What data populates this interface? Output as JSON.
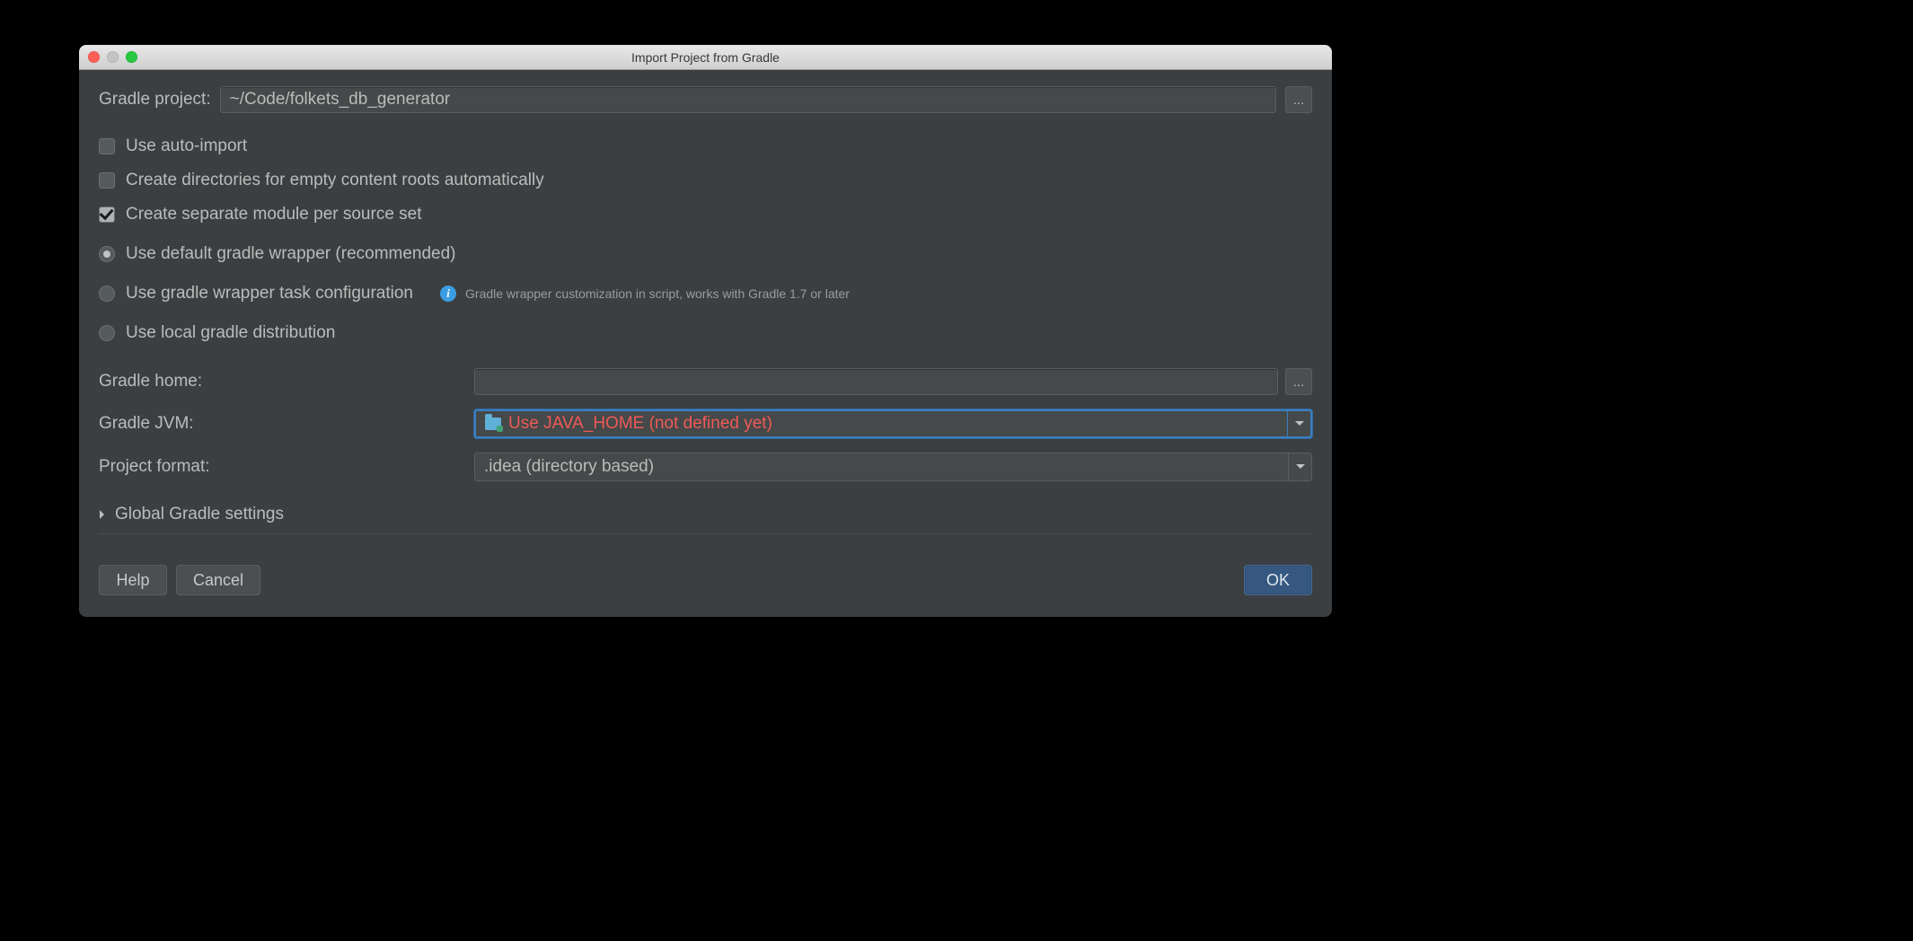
{
  "window": {
    "title": "Import Project from Gradle"
  },
  "gradleProject": {
    "label": "Gradle project:",
    "value": "~/Code/folkets_db_generator",
    "browse": "..."
  },
  "checkboxes": {
    "autoImport": {
      "label": "Use auto-import",
      "checked": false
    },
    "createDirs": {
      "label": "Create directories for empty content roots automatically",
      "checked": false
    },
    "separateModule": {
      "label": "Create separate module per source set",
      "checked": true
    }
  },
  "radios": {
    "defaultWrapper": {
      "label": "Use default gradle wrapper (recommended)",
      "selected": true
    },
    "wrapperTask": {
      "label": "Use gradle wrapper task configuration",
      "selected": false,
      "hint": "Gradle wrapper customization in script, works with Gradle 1.7 or later"
    },
    "localDist": {
      "label": "Use local gradle distribution",
      "selected": false
    }
  },
  "gradleHome": {
    "label": "Gradle home:",
    "value": "",
    "browse": "..."
  },
  "gradleJvm": {
    "label": "Gradle JVM:",
    "value": "Use JAVA_HOME (not defined yet)"
  },
  "projectFormat": {
    "label": "Project format:",
    "value": ".idea (directory based)"
  },
  "expander": {
    "label": "Global Gradle settings"
  },
  "buttons": {
    "help": "Help",
    "cancel": "Cancel",
    "ok": "OK"
  }
}
